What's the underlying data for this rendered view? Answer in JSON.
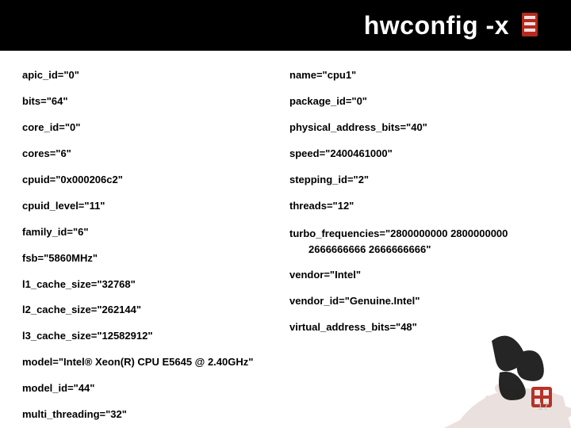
{
  "title": "hwconfig -x",
  "page_number": "17",
  "left": [
    {
      "k": "apic_id",
      "v": "\"0\""
    },
    {
      "k": "bits",
      "v": "\"64\""
    },
    {
      "k": "core_id",
      "v": "\"0\""
    },
    {
      "k": "cores",
      "v": "\"6\""
    },
    {
      "k": "cpuid",
      "v": "\"0x000206c2\""
    },
    {
      "k": "cpuid_level",
      "v": "\"11\""
    },
    {
      "k": "family_id",
      "v": "\"6\""
    },
    {
      "k": "fsb",
      "v": "\"5860MHz\""
    },
    {
      "k": "l1_cache_size",
      "v": "\"32768\""
    },
    {
      "k": "l2_cache_size",
      "v": "\"262144\""
    },
    {
      "k": "l3_cache_size",
      "v": "\"12582912\""
    },
    {
      "k": "model",
      "v": "\"Intel® Xeon(R) CPU E5645 @ 2.40GHz\""
    },
    {
      "k": "model_id",
      "v": "\"44\""
    },
    {
      "k": "multi_threading",
      "v": "\"32\""
    }
  ],
  "right": [
    {
      "k": "name",
      "v": "\"cpu1\""
    },
    {
      "k": "package_id",
      "v": "\"0\""
    },
    {
      "k": "physical_address_bits",
      "v": "\"40\""
    },
    {
      "k": "speed",
      "v": "\"2400461000\""
    },
    {
      "k": "stepping_id",
      "v": "\"2\""
    },
    {
      "k": "threads",
      "v": "\"12\""
    }
  ],
  "turbo": {
    "line1": "turbo_frequencies=\"2800000000 2800000000",
    "line2": "2666666666 2666666666\""
  },
  "right_tail": [
    {
      "k": "vendor",
      "v": "\"Intel\""
    },
    {
      "k": "vendor_id",
      "v": "\"Genuine.Intel\""
    },
    {
      "k": "virtual_address_bits",
      "v": "\"48\""
    }
  ]
}
